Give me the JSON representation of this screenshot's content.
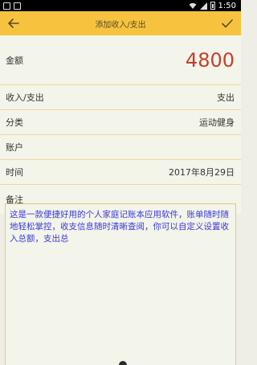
{
  "status_bar": {
    "time": "1:50"
  },
  "toolbar": {
    "title": "添加收入/支出",
    "back_icon": "arrow-left-icon",
    "confirm_icon": "check-icon"
  },
  "form": {
    "amount": {
      "label": "金额",
      "value": "4800"
    },
    "type": {
      "label": "收入/支出",
      "value": "支出"
    },
    "category": {
      "label": "分类",
      "value": "运动健身"
    },
    "account": {
      "label": "账户",
      "value": ""
    },
    "time": {
      "label": "时间",
      "value": "2017年8月29日"
    },
    "notes": {
      "label": "备注",
      "value": "这是一款便捷好用的个人家庭记账本应用软件，账单随时随地轻松掌控，收支信息随时清晰查阅，你可以自定义设置收入总额，支出总"
    }
  },
  "colors": {
    "accent": "#f7c33f",
    "amount": "#c5402b",
    "notes_text": "#3a3ad8",
    "divider": "#f1d79a"
  }
}
